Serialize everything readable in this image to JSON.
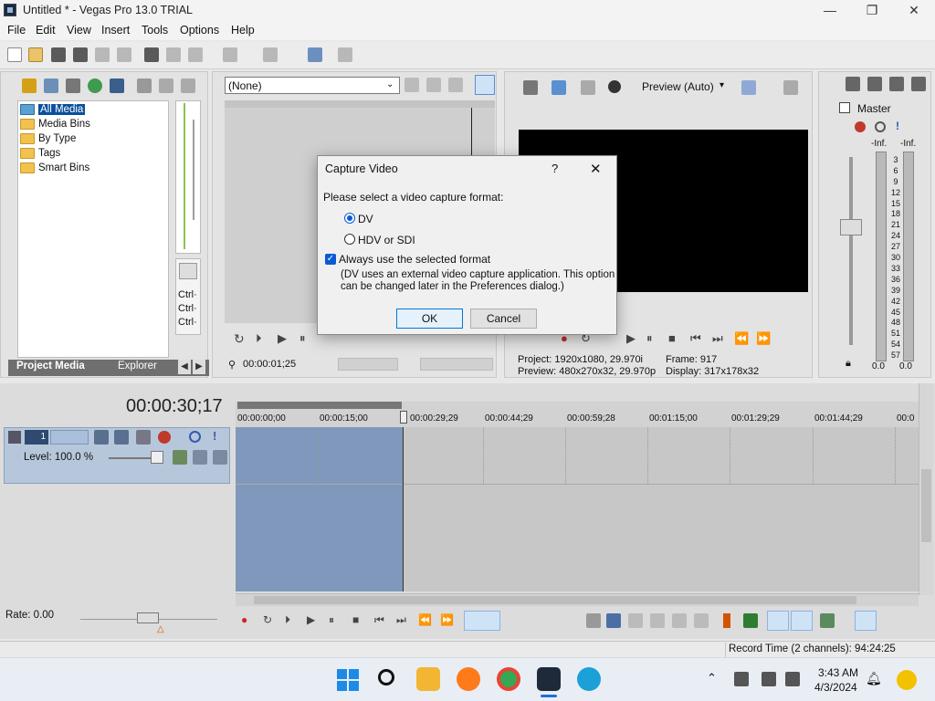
{
  "window": {
    "title": "Untitled * - Vegas Pro 13.0 TRIAL"
  },
  "menu": [
    "File",
    "Edit",
    "View",
    "Insert",
    "Tools",
    "Options",
    "Help"
  ],
  "project_media": {
    "tree": [
      "All Media",
      "Media Bins",
      "By Type",
      "Tags",
      "Smart Bins"
    ],
    "tabs": [
      "Project Media",
      "Explorer"
    ]
  },
  "trimmer": {
    "dropdown_value": "(None)",
    "timecode": "00:00:01;25",
    "ctrl_labels": [
      "Ctrl·",
      "Ctrl·",
      "Ctrl·"
    ]
  },
  "preview": {
    "mode": "Preview (Auto)",
    "project_label": "Project:",
    "project_value": "1920x1080, 29.970i",
    "preview_label": "Preview:",
    "preview_value": "480x270x32, 29.970p",
    "frame_label": "Frame:",
    "frame_value": "917",
    "display_label": "Display:",
    "display_value": "317x178x32"
  },
  "mixer": {
    "master": "Master",
    "inf_left": "-Inf.",
    "inf_right": "-Inf.",
    "scale": [
      "3",
      "6",
      "9",
      "12",
      "15",
      "18",
      "21",
      "24",
      "27",
      "30",
      "33",
      "36",
      "39",
      "42",
      "45",
      "48",
      "51",
      "54",
      "57"
    ],
    "bottom_left": "0.0",
    "bottom_right": "0.0"
  },
  "timeline": {
    "timecode": "00:00:30;17",
    "track_number": "1",
    "level": "Level: 100.0 %",
    "ruler": [
      "00:00:00;00",
      "00:00:15;00",
      "00:00:29;29",
      "00:00:44;29",
      "00:00:59;28",
      "00:01:15;00",
      "00:01:29;29",
      "00:01:44;29",
      "00:0"
    ],
    "rate": "Rate: 0.00"
  },
  "status": {
    "record_time": "Record Time (2 channels): 94:24:25"
  },
  "taskbar": {
    "time": "3:43 AM",
    "date": "4/3/2024"
  },
  "dialog": {
    "title": "Capture Video",
    "help": "?",
    "close": "✕",
    "prompt": "Please select a video capture format:",
    "options": [
      "DV",
      "HDV or SDI"
    ],
    "selected": "DV",
    "checkbox_label": "Always use the selected format",
    "checkbox_checked": true,
    "note_line1": "(DV uses an external video capture application. This option",
    "note_line2": "can be changed later in the Preferences dialog.)",
    "ok": "OK",
    "cancel": "Cancel"
  },
  "colors": {
    "accent": "#0a5ad4",
    "track_selection": "#7f98bb",
    "media_selection": "#0b4f9c"
  }
}
